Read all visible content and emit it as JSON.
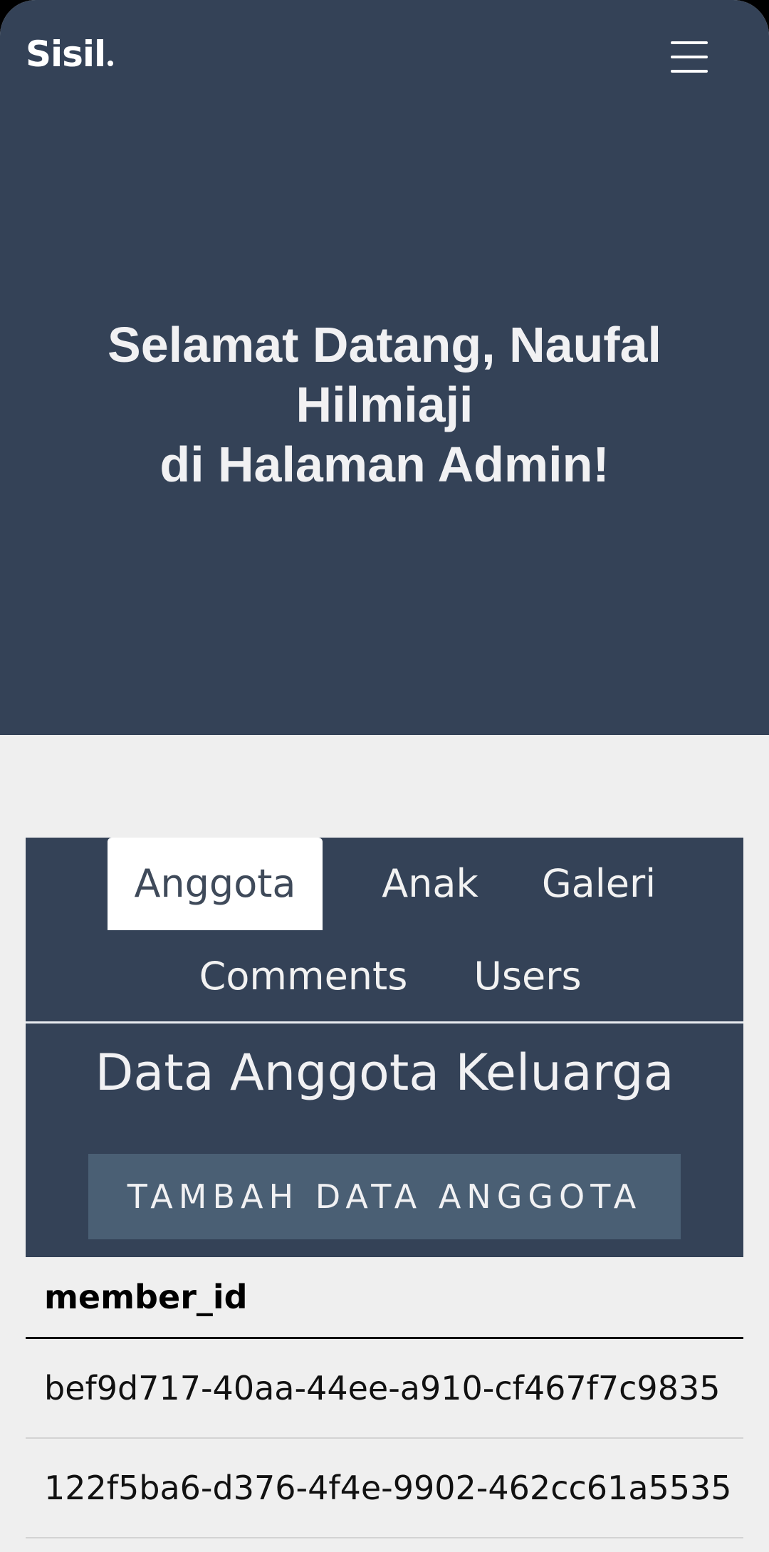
{
  "header": {
    "brand": "Sisil",
    "menu_icon": "hamburger-menu-icon"
  },
  "hero": {
    "line1": "Selamat Datang, Naufal",
    "line2": "Hilmiaji",
    "line3": "di Halaman Admin!"
  },
  "tabs": [
    {
      "label": "Anggota",
      "active": true
    },
    {
      "label": "Anak",
      "active": false
    },
    {
      "label": "Galeri",
      "active": false
    },
    {
      "label": "Comments",
      "active": false
    },
    {
      "label": "Users",
      "active": false
    }
  ],
  "section": {
    "title": "Data Anggota Keluarga",
    "add_button": "TAMBAH DATA ANGGOTA"
  },
  "table": {
    "columns": [
      "member_id"
    ],
    "rows": [
      [
        "bef9d717-40aa-44ee-a910-cf467f7c9835"
      ],
      [
        "122f5ba6-d376-4f4e-9902-462cc61a5535"
      ]
    ]
  },
  "colors": {
    "primary": "#344257",
    "button": "#4a5f74",
    "page_background": "#efefef"
  }
}
